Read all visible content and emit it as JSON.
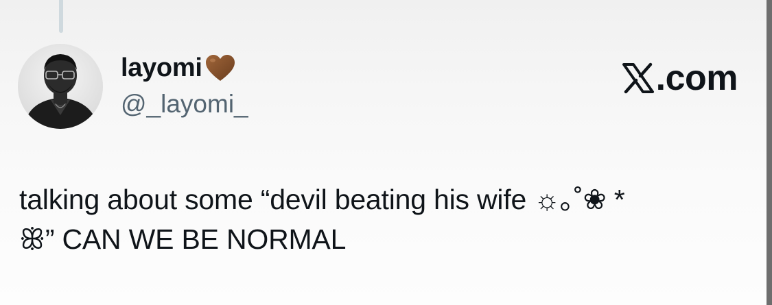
{
  "tweet": {
    "author": {
      "display_name": "layomi",
      "emoji": "brown-heart",
      "handle": "@_layomi_",
      "avatar": "profile-photo-grayscale"
    },
    "text_line1": "talking about some “devil beating his wife ☼｡˚❀ *",
    "text_line2": "ꕥ” CAN WE BE NORMAL"
  },
  "watermark": {
    "label": ".com",
    "logo": "x-logo"
  },
  "colors": {
    "text_primary": "#0f1419",
    "text_secondary": "#536471",
    "thread_line": "#cfd9de",
    "heart": "#7b4a27",
    "edge": "#6e6e6e"
  }
}
